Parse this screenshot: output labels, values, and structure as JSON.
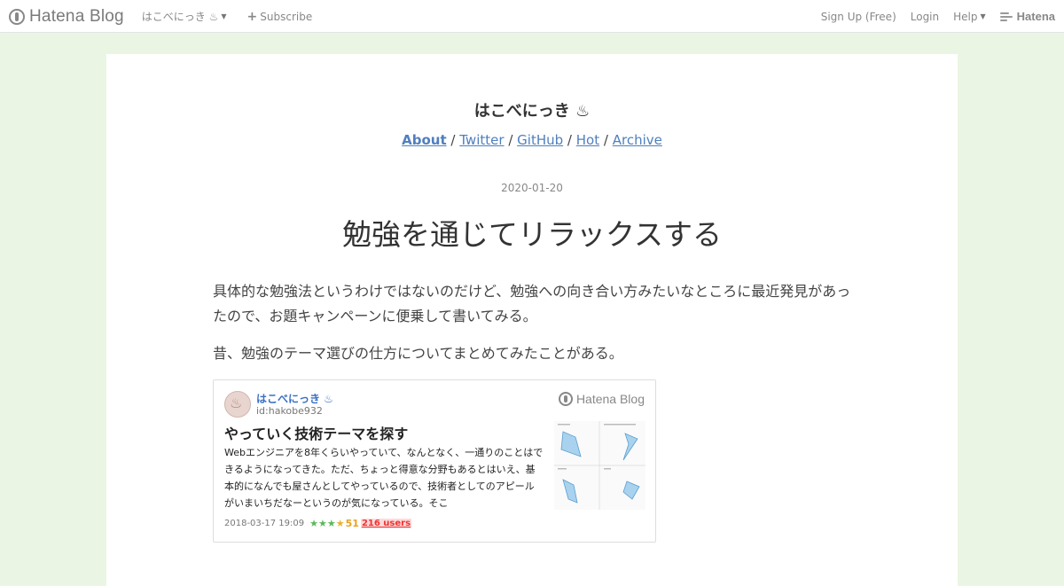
{
  "topbar": {
    "logo_text": "Hatena Blog",
    "blog_menu_label": "はこべにっき ♨",
    "subscribe_label": "Subscribe",
    "signup_label": "Sign Up (Free)",
    "login_label": "Login",
    "help_label": "Help",
    "brand_label": "Hatena"
  },
  "blog": {
    "title": "はこべにっき ♨",
    "nav": [
      {
        "label": "About"
      },
      {
        "label": "Twitter"
      },
      {
        "label": "GitHub"
      },
      {
        "label": "Hot"
      },
      {
        "label": "Archive"
      }
    ],
    "nav_separator": "/"
  },
  "entry": {
    "date": "2020-01-20",
    "title": "勉強を通じてリラックスする",
    "paragraphs": [
      "具体的な勉強法というわけではないのだけど、勉強への向き合い方みたいなところに最近発見があったので、お題キャンペーンに便乗して書いてみる。",
      "昔、勉強のテーマ選びの仕方についてまとめてみたことがある。"
    ]
  },
  "embed": {
    "blog_name": "はこべにっき ♨",
    "user_id": "id:hakobe932",
    "brand": "Hatena Blog",
    "title": "やっていく技術テーマを探す",
    "description": "Webエンジニアを8年くらいやっていて、なんとなく、一通りのことはできるようになってきた。ただ、ちょっと得意な分野もあるとはいえ、基本的になんでも屋さんとしてやっているので、技術者としてのアピールがいまいちだなーというのが気になっている。そこ",
    "datetime": "2018-03-17 19:09",
    "star_count": "51",
    "users_label": "216 users"
  }
}
